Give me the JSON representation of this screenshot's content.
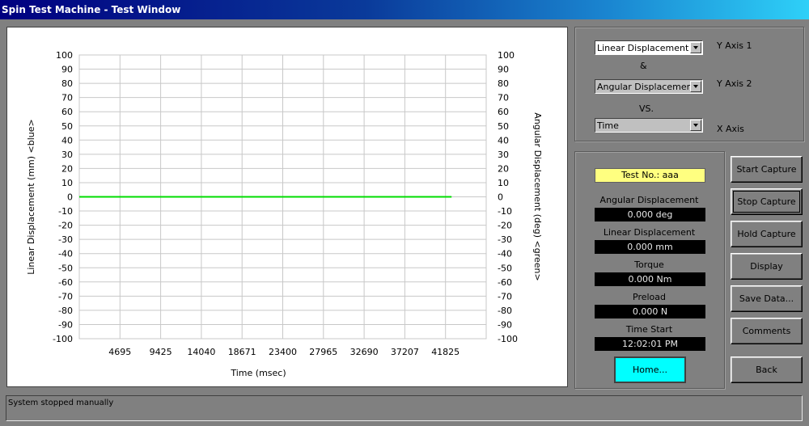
{
  "window": {
    "title": "Spin Test Machine - Test Window"
  },
  "axis_select": {
    "y1": {
      "value": "Linear Displacement",
      "label": "Y Axis 1"
    },
    "and_text": "&",
    "y2": {
      "value": "Angular Displacement",
      "label": "Y Axis 2"
    },
    "vs_text": "VS.",
    "x": {
      "value": "Time",
      "label": "X Axis"
    }
  },
  "readings": {
    "test_no": "Test No.: aaa",
    "angular": {
      "label": "Angular Displacement",
      "value": "0.000 deg"
    },
    "linear": {
      "label": "Linear Displacement",
      "value": "0.000 mm"
    },
    "torque": {
      "label": "Torque",
      "value": "0.000 Nm"
    },
    "preload": {
      "label": "Preload",
      "value": "0.000 N"
    },
    "time_start": {
      "label": "Time Start",
      "value": "12:02:01 PM"
    },
    "home_label": "Home..."
  },
  "buttons": {
    "start": "Start Capture",
    "stop": "Stop Capture",
    "hold": "Hold Capture",
    "display": "Display",
    "save": "Save Data...",
    "comments": "Comments",
    "back": "Back"
  },
  "status": {
    "text": "System stopped manually"
  },
  "colors": {
    "y1_series": "#0000ff",
    "y2_series": "#00dd00",
    "grid": "#c8c8c8"
  },
  "chart_data": {
    "type": "line",
    "xlabel": "Time (msec)",
    "ylabel": "Linear Displacement (mm) <blue>",
    "y2label": "Angular Displacement (deg) <green>",
    "ylim": [
      -100,
      100
    ],
    "y2lim": [
      -100,
      100
    ],
    "yticks": [
      100,
      90,
      80,
      70,
      60,
      50,
      40,
      30,
      20,
      10,
      0,
      -10,
      -20,
      -30,
      -40,
      -50,
      -60,
      -70,
      -80,
      -90,
      -100
    ],
    "xticks": [
      "4695",
      "9425",
      "14040",
      "18671",
      "23400",
      "27965",
      "32690",
      "37207",
      "41825"
    ],
    "xlim": [
      0,
      47000
    ],
    "grid": true,
    "series": [
      {
        "color": "#00dd00",
        "x": [
          0,
          43000
        ],
        "y": [
          0,
          0
        ],
        "axis": "y2"
      }
    ]
  }
}
